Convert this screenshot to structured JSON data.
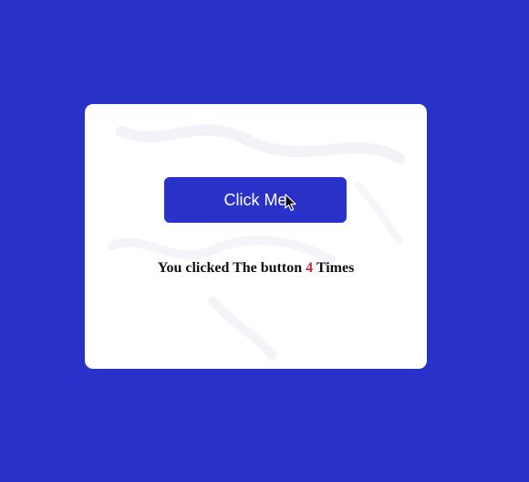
{
  "colors": {
    "background": "#2a31c8",
    "card": "#ffffff",
    "button": "#2a31c8",
    "button_text": "#ffffff",
    "count": "#c8283c"
  },
  "button": {
    "label": "Click Me"
  },
  "counter": {
    "prefix": "You clicked The button",
    "count": "4",
    "suffix": "Times"
  },
  "cursor": {
    "icon": "arrow-pointer-icon"
  }
}
